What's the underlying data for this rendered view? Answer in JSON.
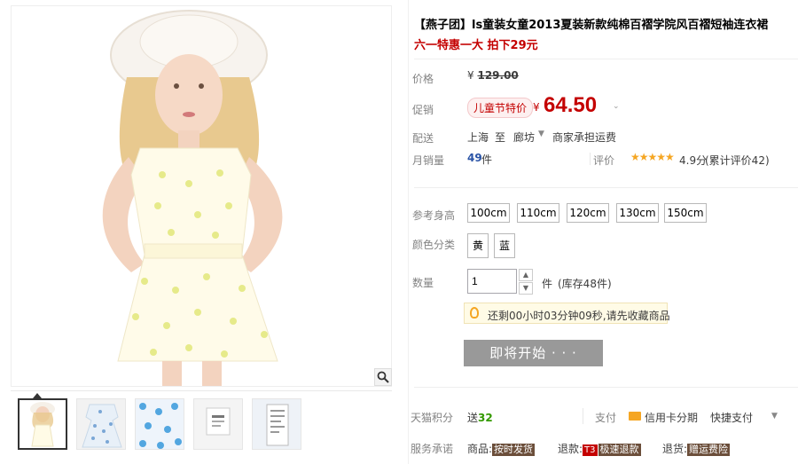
{
  "product": {
    "title": "【燕子团】ls童装女童2013夏装新款纯棉百褶学院风百褶短袖连衣裙",
    "subtitle": "六一特惠一大 拍下29元"
  },
  "price": {
    "label": "价格",
    "currency": "¥",
    "original": "129.00"
  },
  "promo": {
    "label": "促销",
    "tag": "儿童节特价",
    "currency": "¥",
    "price": "64.50"
  },
  "shipping": {
    "label": "配送",
    "from": "上海",
    "to_word": "至",
    "to_city": "廊坊",
    "fee": "商家承担运费"
  },
  "sales": {
    "label": "月销量",
    "count": "49",
    "unit": "件"
  },
  "rating": {
    "label": "评价",
    "stars": "★★★★★",
    "score": "4.9分",
    "count_text": "(累计评价42)"
  },
  "size": {
    "label": "参考身高",
    "options": [
      "100cm",
      "110cm",
      "120cm",
      "130cm",
      "150cm"
    ]
  },
  "color": {
    "label": "颜色分类",
    "options": [
      "黄",
      "蓝"
    ]
  },
  "quantity": {
    "label": "数量",
    "value": "1",
    "unit": "件",
    "stock": "(库存48件)"
  },
  "tip": {
    "text": "还剩00小时03分钟09秒,请先收藏商品"
  },
  "buy_button": {
    "label": "即将开始 · · ·"
  },
  "points": {
    "label": "天猫积分",
    "prefix": "送",
    "value": "32"
  },
  "payment": {
    "label": "支付",
    "card": "信用卡分期",
    "quick": "快捷支付"
  },
  "service": {
    "label": "服务承诺",
    "goods_prefix": "商品:",
    "goods_tag": "按时发货",
    "refund_prefix": "退款:",
    "refund_badge": "T3",
    "refund_tag": "极速退款",
    "return_prefix": "退货:",
    "return_tag": "赠运费险"
  },
  "gallery": {
    "thumbnail_count": 5,
    "active_index": 0
  },
  "colors": {
    "accent": "#c40000",
    "link": "#2953a6",
    "star": "#f5a623",
    "button_disabled": "#999999"
  }
}
